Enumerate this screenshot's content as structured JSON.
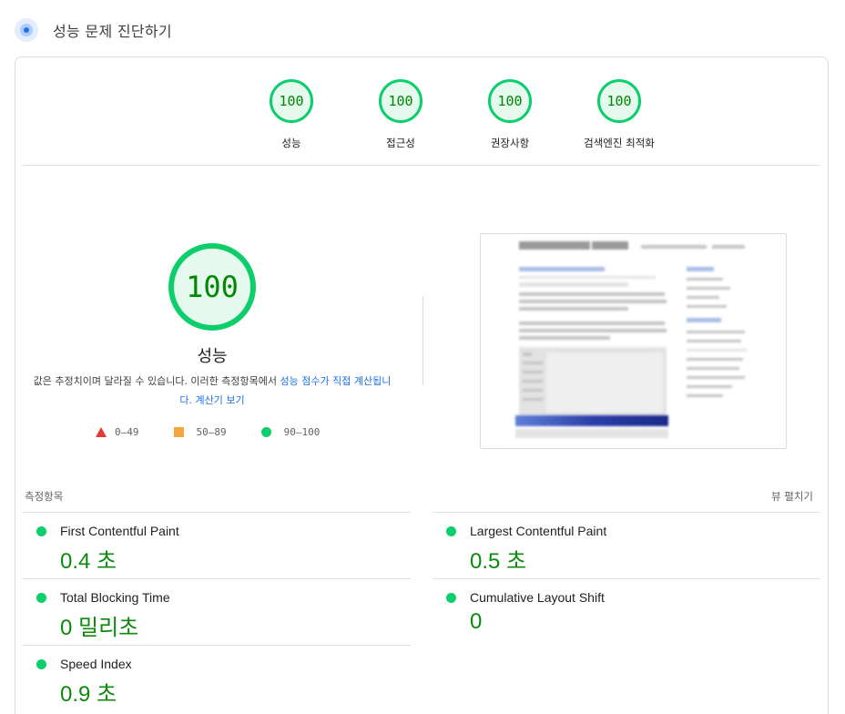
{
  "header": {
    "title": "성능 문제 진단하기",
    "icon": "diagnose-icon"
  },
  "categories": [
    {
      "score": "100",
      "label": "성능"
    },
    {
      "score": "100",
      "label": "접근성"
    },
    {
      "score": "100",
      "label": "권장사항"
    },
    {
      "score": "100",
      "label": "검색엔진 최적화"
    }
  ],
  "main": {
    "score": "100",
    "label": "성능",
    "description_text": "값은 추정치이며 달라질 수 있습니다. 이러한 측정항목에서 ",
    "description_link": "성능 점수가 직접 계산됩니다.",
    "calculator_link": "계산기 보기"
  },
  "legend": [
    {
      "shape": "triangle",
      "range": "0–49",
      "color": "#e53935"
    },
    {
      "shape": "square",
      "range": "50–89",
      "color": "#f4a83a"
    },
    {
      "shape": "circle",
      "range": "90–100",
      "color": "#0cce6b"
    }
  ],
  "metrics_section": {
    "title": "측정항목",
    "toggle": "뷰 펼치기"
  },
  "metrics": [
    {
      "name": "First Contentful Paint",
      "value": "0.4 초"
    },
    {
      "name": "Largest Contentful Paint",
      "value": "0.5 초"
    },
    {
      "name": "Total Blocking Time",
      "value": "0 밀리초"
    },
    {
      "name": "Cumulative Layout Shift",
      "value": "0"
    },
    {
      "name": "Speed Index",
      "value": "0.9 초"
    }
  ],
  "colors": {
    "pass": "#0cce6b",
    "pass_text": "#008800",
    "link": "#1a73e8"
  }
}
